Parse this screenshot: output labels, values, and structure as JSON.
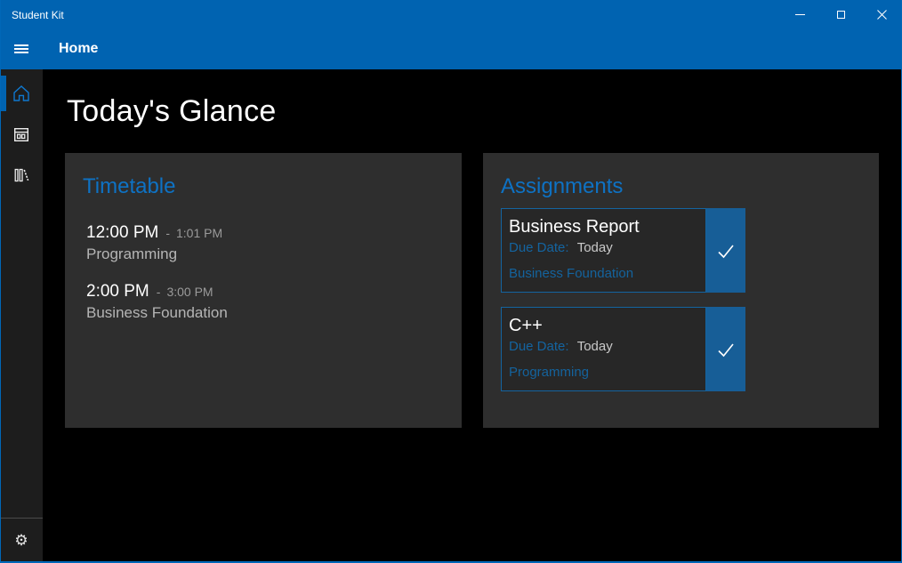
{
  "window": {
    "title": "Student Kit"
  },
  "header": {
    "title": "Home"
  },
  "sidebar": {
    "items": [
      {
        "id": "home",
        "icon": "home-icon",
        "selected": true
      },
      {
        "id": "timetable",
        "icon": "calendar-icon",
        "selected": false
      },
      {
        "id": "courses",
        "icon": "library-icon",
        "selected": false
      }
    ],
    "settings_glyph": "⚙"
  },
  "main": {
    "heading": "Today's Glance"
  },
  "timetable": {
    "title": "Timetable",
    "entries": [
      {
        "start": "12:00 PM",
        "dash": "-",
        "end": "1:01 PM",
        "course": "Programming"
      },
      {
        "start": "2:00 PM",
        "dash": "-",
        "end": "3:00 PM",
        "course": "Business Foundation"
      }
    ]
  },
  "assignments": {
    "title": "Assignments",
    "items": [
      {
        "title": "Business Report",
        "due_label": "Due Date:",
        "due_value": "Today",
        "course": "Business Foundation"
      },
      {
        "title": "C++",
        "due_label": "Due Date:",
        "due_value": "Today",
        "course": "Programming"
      }
    ]
  },
  "icons": {
    "hamburger": "menu-lines",
    "home": "house-outline",
    "timetable": "calendar",
    "courses": "library-books",
    "settings": "gear",
    "minimize": "–",
    "maximize": "▢",
    "close": "✕",
    "complete": "✓"
  },
  "colors": {
    "accent": "#0063B1",
    "section_title_blue": "#0E72C4",
    "muted_blue": "#14639D",
    "check_button_blue": "#175E97",
    "card_border_blue": "#1464A0",
    "panel_background": "#2E2E2E",
    "sidebar_background": "#1D1D1D",
    "content_background": "#000000"
  }
}
